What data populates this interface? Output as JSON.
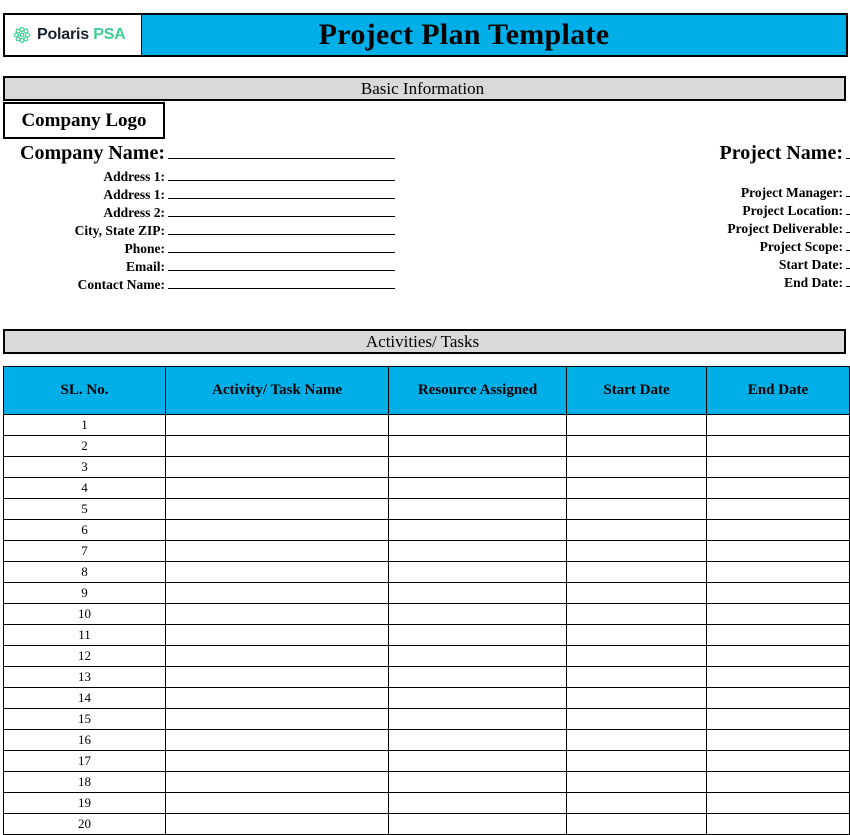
{
  "header": {
    "logo": {
      "icon": "flower-rosette-icon",
      "brand_primary": "Polaris",
      "brand_secondary": "PSA",
      "color_primary": "#16232e",
      "color_secondary": "#3ECF8E"
    },
    "title": "Project Plan Template",
    "bar_color": "#00AEE8"
  },
  "sections": {
    "basic_information": {
      "banner_label": "Basic Information",
      "banner_color": "#D9D9D9",
      "company_logo_placeholder": "Company Logo",
      "left_fields": [
        {
          "label": "Company Name:",
          "value": "",
          "emphasis": "large"
        },
        {
          "label": "Address 1:",
          "value": ""
        },
        {
          "label": "Address 1:",
          "value": ""
        },
        {
          "label": "Address 2:",
          "value": ""
        },
        {
          "label": "City, State ZIP:",
          "value": ""
        },
        {
          "label": "Phone:",
          "value": ""
        },
        {
          "label": "Email:",
          "value": ""
        },
        {
          "label": "Contact Name:",
          "value": ""
        }
      ],
      "right_fields": [
        {
          "label": "Project Name:",
          "value": "",
          "emphasis": "large"
        },
        {
          "label": "Project Manager:",
          "value": ""
        },
        {
          "label": "Project Location:",
          "value": ""
        },
        {
          "label": "Project Deliverable:",
          "value": ""
        },
        {
          "label": "Project Scope:",
          "value": ""
        },
        {
          "label": "Start Date:",
          "value": ""
        },
        {
          "label": "End Date:",
          "value": ""
        }
      ]
    },
    "activities_tasks": {
      "banner_label": "Activities/ Tasks",
      "banner_color": "#D9D9D9",
      "table": {
        "header_color": "#00AEE8",
        "columns": [
          "SL. No.",
          "Activity/ Task Name",
          "Resource Assigned",
          "Start Date",
          "End Date"
        ],
        "rows": [
          {
            "sl": "1",
            "activity": "",
            "resource": "",
            "start": "",
            "end": ""
          },
          {
            "sl": "2",
            "activity": "",
            "resource": "",
            "start": "",
            "end": ""
          },
          {
            "sl": "3",
            "activity": "",
            "resource": "",
            "start": "",
            "end": ""
          },
          {
            "sl": "4",
            "activity": "",
            "resource": "",
            "start": "",
            "end": ""
          },
          {
            "sl": "5",
            "activity": "",
            "resource": "",
            "start": "",
            "end": ""
          },
          {
            "sl": "6",
            "activity": "",
            "resource": "",
            "start": "",
            "end": ""
          },
          {
            "sl": "7",
            "activity": "",
            "resource": "",
            "start": "",
            "end": ""
          },
          {
            "sl": "8",
            "activity": "",
            "resource": "",
            "start": "",
            "end": ""
          },
          {
            "sl": "9",
            "activity": "",
            "resource": "",
            "start": "",
            "end": ""
          },
          {
            "sl": "10",
            "activity": "",
            "resource": "",
            "start": "",
            "end": ""
          },
          {
            "sl": "11",
            "activity": "",
            "resource": "",
            "start": "",
            "end": ""
          },
          {
            "sl": "12",
            "activity": "",
            "resource": "",
            "start": "",
            "end": ""
          },
          {
            "sl": "13",
            "activity": "",
            "resource": "",
            "start": "",
            "end": ""
          },
          {
            "sl": "14",
            "activity": "",
            "resource": "",
            "start": "",
            "end": ""
          },
          {
            "sl": "15",
            "activity": "",
            "resource": "",
            "start": "",
            "end": ""
          },
          {
            "sl": "16",
            "activity": "",
            "resource": "",
            "start": "",
            "end": ""
          },
          {
            "sl": "17",
            "activity": "",
            "resource": "",
            "start": "",
            "end": ""
          },
          {
            "sl": "18",
            "activity": "",
            "resource": "",
            "start": "",
            "end": ""
          },
          {
            "sl": "19",
            "activity": "",
            "resource": "",
            "start": "",
            "end": ""
          },
          {
            "sl": "20",
            "activity": "",
            "resource": "",
            "start": "",
            "end": ""
          }
        ]
      }
    }
  }
}
